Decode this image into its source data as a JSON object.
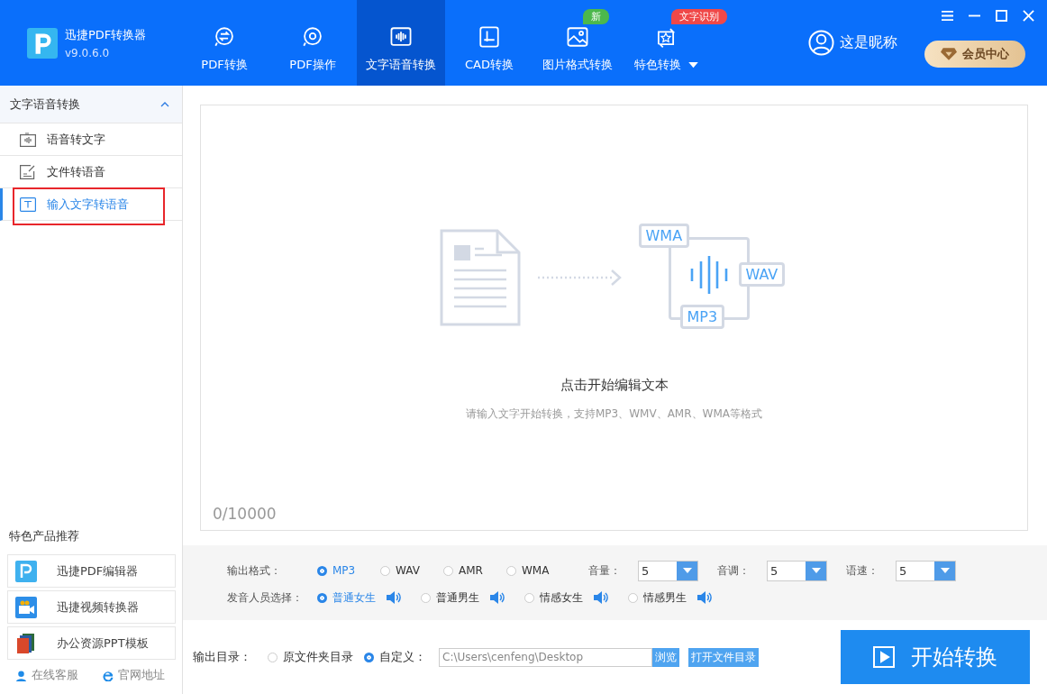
{
  "app": {
    "name": "迅捷PDF转换器",
    "version": "v9.0.6.0"
  },
  "nav_tabs": [
    {
      "label": "PDF转换",
      "selected": false,
      "kind": "swap"
    },
    {
      "label": "PDF操作",
      "selected": false,
      "kind": "gear"
    },
    {
      "label": "文字语音转换",
      "selected": true,
      "kind": "wave"
    },
    {
      "label": "CAD转换",
      "selected": false,
      "kind": "cad"
    },
    {
      "label": "图片格式转换",
      "selected": false,
      "kind": "image",
      "badge": "新",
      "color": "#4cb84c"
    },
    {
      "label": "特色转换",
      "selected": false,
      "kind": "star",
      "badge": "文字识别",
      "color": "#f04848",
      "dropdown": true
    }
  ],
  "user": {
    "nickname": "这是昵称"
  },
  "vip_button": "会员中心",
  "sidebar": {
    "section_title": "文字语音转换",
    "expanded": true,
    "items": [
      {
        "label": "语音转文字",
        "selected": false,
        "kind": "audio",
        "highlighted": false
      },
      {
        "label": "文件转语音",
        "selected": false,
        "kind": "file",
        "highlighted": false
      },
      {
        "label": "输入文字转语音",
        "selected": true,
        "kind": "text",
        "highlighted": true
      }
    ],
    "recommend_title": "特色产品推荐",
    "products": [
      {
        "name": "迅捷PDF编辑器",
        "kind": "pdf"
      },
      {
        "name": "迅捷视频转换器",
        "kind": "video"
      },
      {
        "name": "办公资源PPT模板",
        "kind": "ppt"
      }
    ],
    "footer_links": [
      {
        "label": "在线客服",
        "kind": "support"
      },
      {
        "label": "官网地址",
        "kind": "web"
      }
    ]
  },
  "editor": {
    "illustration_labels": [
      "WMA",
      "WAV",
      "MP3"
    ],
    "title": "点击开始编辑文本",
    "hint": "请输入文字开始转换，支持MP3、WMV、AMR、WMA等格式",
    "counter": "0/10000"
  },
  "settings": {
    "format": {
      "label": "输出格式：",
      "options": [
        {
          "label": "MP3",
          "selected": true
        },
        {
          "label": "WAV",
          "selected": false
        },
        {
          "label": "AMR",
          "selected": false
        },
        {
          "label": "WMA",
          "selected": false
        }
      ]
    },
    "selects": [
      {
        "label": "音量：",
        "value": "5"
      },
      {
        "label": "音调：",
        "value": "5"
      },
      {
        "label": "语速：",
        "value": "5"
      }
    ],
    "voice": {
      "label": "发音人员选择：",
      "options": [
        {
          "label": "普通女生",
          "selected": true
        },
        {
          "label": "普通男生",
          "selected": false
        },
        {
          "label": "情感女生",
          "selected": false
        },
        {
          "label": "情感男生",
          "selected": false
        }
      ]
    }
  },
  "output": {
    "label": "输出目录：",
    "options": [
      {
        "label": "原文件夹目录",
        "selected": false
      },
      {
        "label": "自定义：",
        "selected": true
      }
    ],
    "path": "C:\\Users\\cenfeng\\Desktop",
    "browse": "浏览",
    "open_folder": "打开文件目录"
  },
  "start_button": "开始转换"
}
